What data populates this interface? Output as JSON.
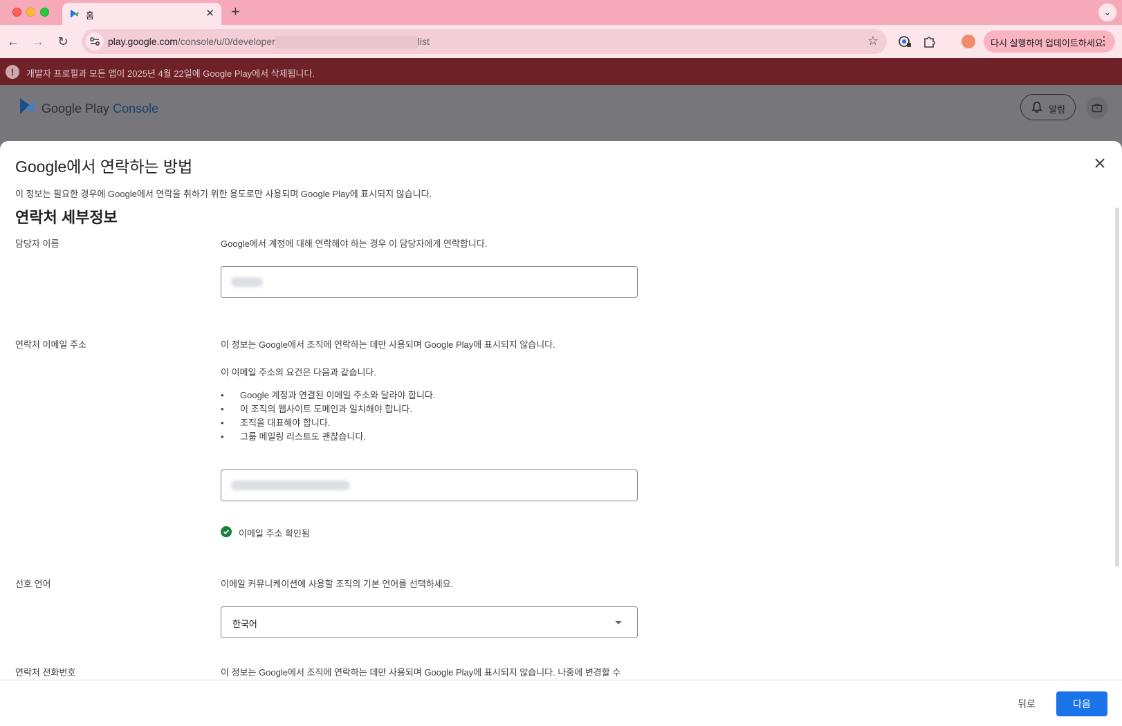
{
  "browser": {
    "tab_title": "홈",
    "tab_close_glyph": "✕",
    "new_tab_glyph": "+",
    "url_host": "play.google.com",
    "url_path_start": "/console/u/0/developer",
    "url_path_end": "list",
    "update_label": "다시 실행하여 업데이트하세요.",
    "menu_glyph": "⋮",
    "back_glyph": "←",
    "forward_glyph": "→",
    "reload_glyph": "↻",
    "star_glyph": "☆",
    "tab_search_glyph": "⌄"
  },
  "banner": {
    "icon_glyph": "!",
    "text": "개발자 프로필과 모든 앱이 2025년 4월 22일에 Google Play에서 삭제됩니다."
  },
  "header": {
    "brand": "Google Play",
    "brand_product": "Console",
    "alerts_label": "알림"
  },
  "modal": {
    "title": "Google에서 연락하는 방법",
    "subtitle": "이 정보는 필요한 경우에 Google에서 연락을 취하기 위한 용도로만 사용되며 Google Play에 표시되지 않습니다.",
    "section_title": "연락처 세부정보",
    "contact_name": {
      "label": "담당자 이름",
      "description": "Google에서 계정에 대해 연락해야 하는 경우 이 담당자에게 연락합니다."
    },
    "contact_email": {
      "label": "연락처 이메일 주소",
      "description": "이 정보는 Google에서 조직에 연락하는 데만 사용되며 Google Play에 표시되지 않습니다.",
      "requirements_intro": "이 이메일 주소의 요건은 다음과 같습니다.",
      "requirements": [
        "Google 계정과 연결된 이메일 주소와 달라야 합니다.",
        "이 조직의 웹사이트 도메인과 일치해야 합니다.",
        "조직을 대표해야 합니다.",
        "그룹 메일링 리스트도 괜찮습니다."
      ],
      "verified_text": "이메일 주소 확인됨"
    },
    "preferred_language": {
      "label": "선호 언어",
      "description": "이메일 커뮤니케이션에 사용할 조직의 기본 언어를 선택하세요.",
      "selected": "한국어"
    },
    "contact_phone": {
      "label": "연락처 전화번호",
      "description": "이 정보는 Google에서 조직에 연락하는 데만 사용되며 Google Play에 표시되지 않습니다. 나중에 변경할 수"
    }
  },
  "footer": {
    "back_label": "뒤로",
    "next_label": "다음"
  },
  "colors": {
    "primary": "#1a73e8",
    "banner": "#6e2127",
    "verified": "#188038",
    "tab_strip": "#f6a9b8"
  }
}
